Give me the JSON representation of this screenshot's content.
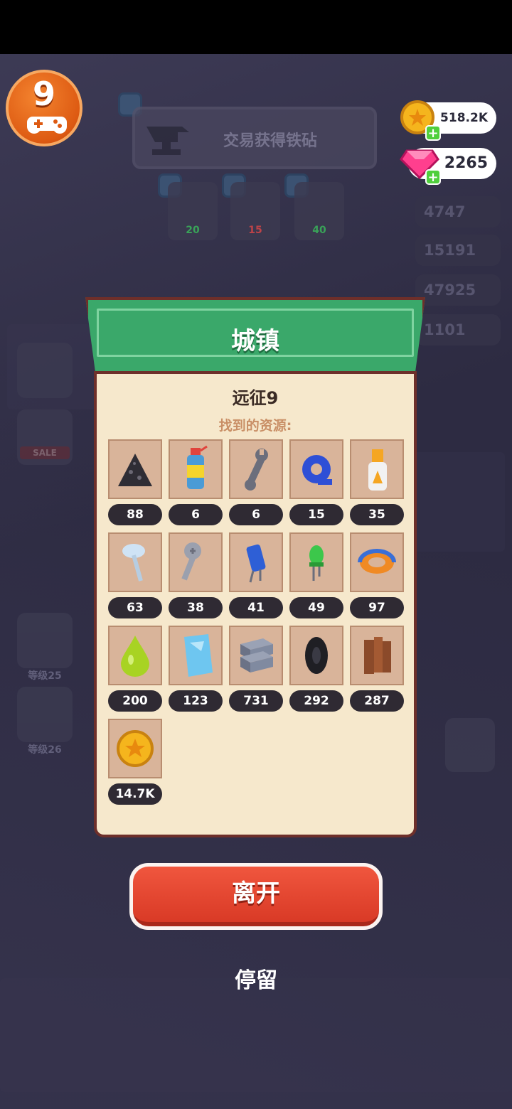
{
  "level": {
    "value": "9"
  },
  "quest": {
    "text": "交易获得铁砧",
    "items": [
      {
        "value": "20",
        "color": "#3bbf5c"
      },
      {
        "value": "15",
        "color": "#e04848"
      },
      {
        "value": "40",
        "color": "#3bbf5c"
      }
    ]
  },
  "currencies": {
    "coins": "518.2K",
    "gems": "2265"
  },
  "side_stats": [
    "4747",
    "15191",
    "47925",
    "1101"
  ],
  "side_buttons": [
    "等级25",
    "等级26"
  ],
  "sale_label": "SALE",
  "panel": {
    "title": "城镇",
    "subtitle": "远征9",
    "caption": "找到的资源:",
    "resources": [
      {
        "icon": "ore-pile-icon",
        "count": "88"
      },
      {
        "icon": "spray-can-icon",
        "count": "6"
      },
      {
        "icon": "wrench-icon",
        "count": "6"
      },
      {
        "icon": "tape-roll-icon",
        "count": "15"
      },
      {
        "icon": "glue-bottle-icon",
        "count": "35"
      },
      {
        "icon": "nail-icon",
        "count": "63"
      },
      {
        "icon": "screw-icon",
        "count": "38"
      },
      {
        "icon": "capacitor-icon",
        "count": "41"
      },
      {
        "icon": "led-icon",
        "count": "49"
      },
      {
        "icon": "magnet-icon",
        "count": "97"
      },
      {
        "icon": "green-drop-icon",
        "count": "200"
      },
      {
        "icon": "glass-pane-icon",
        "count": "123"
      },
      {
        "icon": "steel-ingot-icon",
        "count": "731"
      },
      {
        "icon": "tire-icon",
        "count": "292"
      },
      {
        "icon": "wood-planks-icon",
        "count": "287"
      },
      {
        "icon": "gold-coin-icon",
        "count": "14.7K"
      }
    ]
  },
  "buttons": {
    "leave": "离开",
    "stay": "停留"
  }
}
